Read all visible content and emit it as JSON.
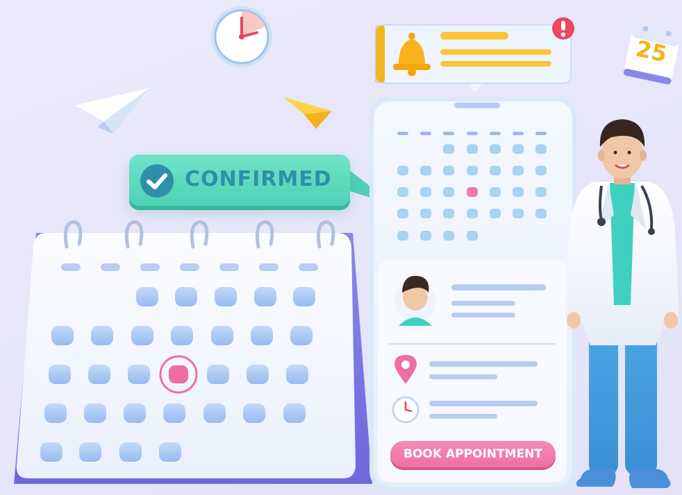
{
  "badge": {
    "confirmed_label": "CONFIRMED"
  },
  "phone": {
    "book_button_label": "BOOK APPOINTMENT"
  },
  "calendar_icon": {
    "date": "25"
  },
  "colors": {
    "accent_teal": "#4fd1b5",
    "accent_pink": "#ee6ea3",
    "accent_yellow": "#f7b21c",
    "cell_blue": "#a9c8f3"
  }
}
